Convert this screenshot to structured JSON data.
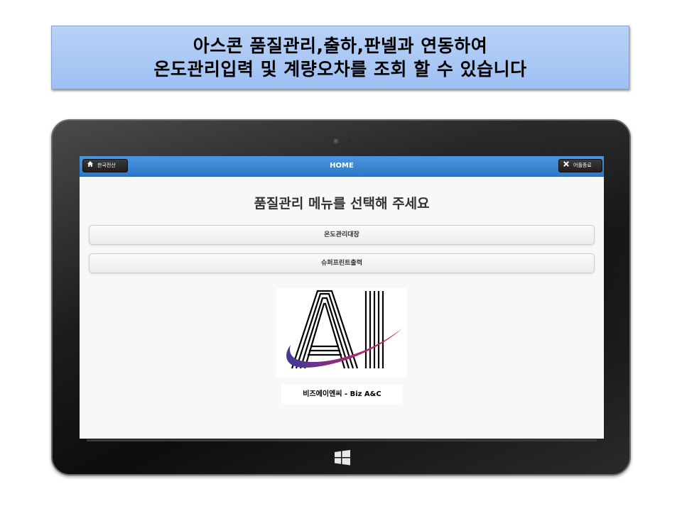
{
  "banner": {
    "line1": "아스콘 품질관리,출하,판넬과 연동하여",
    "line2": "온도관리입력 및 계량오차를 조회 할 수 있습니다"
  },
  "app": {
    "home_button_label": "한국전산",
    "title": "HOME",
    "exit_button_label": "어플종료",
    "heading": "품질관리 메뉴를 선택해 주세요",
    "menu_items": [
      "온도관리대장",
      "슈퍼프린트출력"
    ],
    "logo_text": "AI",
    "caption": "비즈에이엔씨  -  Biz A&C"
  },
  "icons": {
    "home": "home-icon",
    "close": "close-icon",
    "windows": "windows-icon"
  },
  "colors": {
    "banner": "#a8c8f4",
    "topbar": "#3a86d6",
    "logo_swoosh_start": "#3b3b9a",
    "logo_swoosh_end": "#e0195a"
  }
}
